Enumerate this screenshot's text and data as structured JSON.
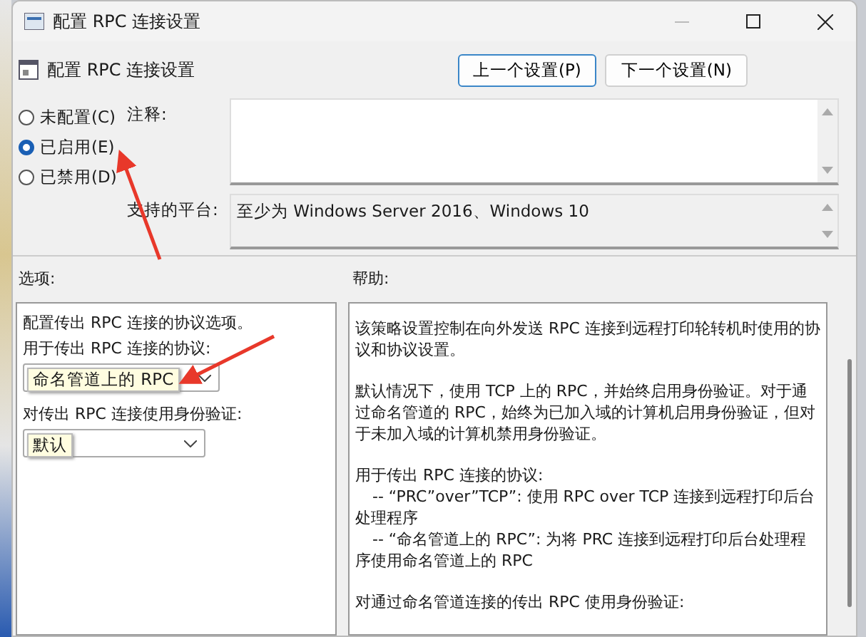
{
  "window": {
    "title": "配置 RPC 连接设置"
  },
  "header": {
    "title": "配置 RPC 连接设置",
    "buttons": [
      {
        "label": "上一个设置(P)",
        "focused": true
      },
      {
        "label": "下一个设置(N)",
        "focused": false
      }
    ]
  },
  "states": [
    {
      "label": "未配置(C)",
      "selected": false
    },
    {
      "label": "已启用(E)",
      "selected": true
    },
    {
      "label": "已禁用(D)",
      "selected": false
    }
  ],
  "comment": {
    "label": "注释:"
  },
  "platform": {
    "label": "支持的平台:",
    "value": "至少为 Windows Server 2016、Windows 10"
  },
  "options": {
    "label": "选项:",
    "intro": "配置传出 RPC 连接的协议选项。",
    "fields": [
      {
        "label": "用于传出 RPC 连接的协议:",
        "tooltip": "命名管道上的 RPC"
      },
      {
        "label": "对传出 RPC 连接使用身份验证:",
        "tooltip": "默认"
      }
    ]
  },
  "help": {
    "label": "帮助:",
    "paragraphs": [
      {
        "kind": "text",
        "lines": [
          "该策略设置控制在向外发送 RPC 连接到远程打印轮转机时使用的协议和协议设置。"
        ]
      },
      {
        "kind": "text",
        "lines": [
          "默认情况下，使用 TCP 上的 RPC，并始终启用身份验证。对于通过命名管道的 RPC，始终为已加入域的计算机启用身份验证，但对于未加入域的计算机禁用身份验证。"
        ]
      },
      {
        "kind": "list",
        "lines": [
          "用于传出 RPC 连接的协议:",
          "-- “PRC”over”TCP”: 使用 RPC over TCP 连接到远程打印后台处理程序",
          "-- “命名管道上的 RPC”: 为将 PRC 连接到远程打印后台处理程序使用命名管道上的 RPC"
        ]
      },
      {
        "kind": "text",
        "lines": [
          "对通过命名管道连接的传出 RPC 使用身份验证:"
        ]
      }
    ]
  }
}
